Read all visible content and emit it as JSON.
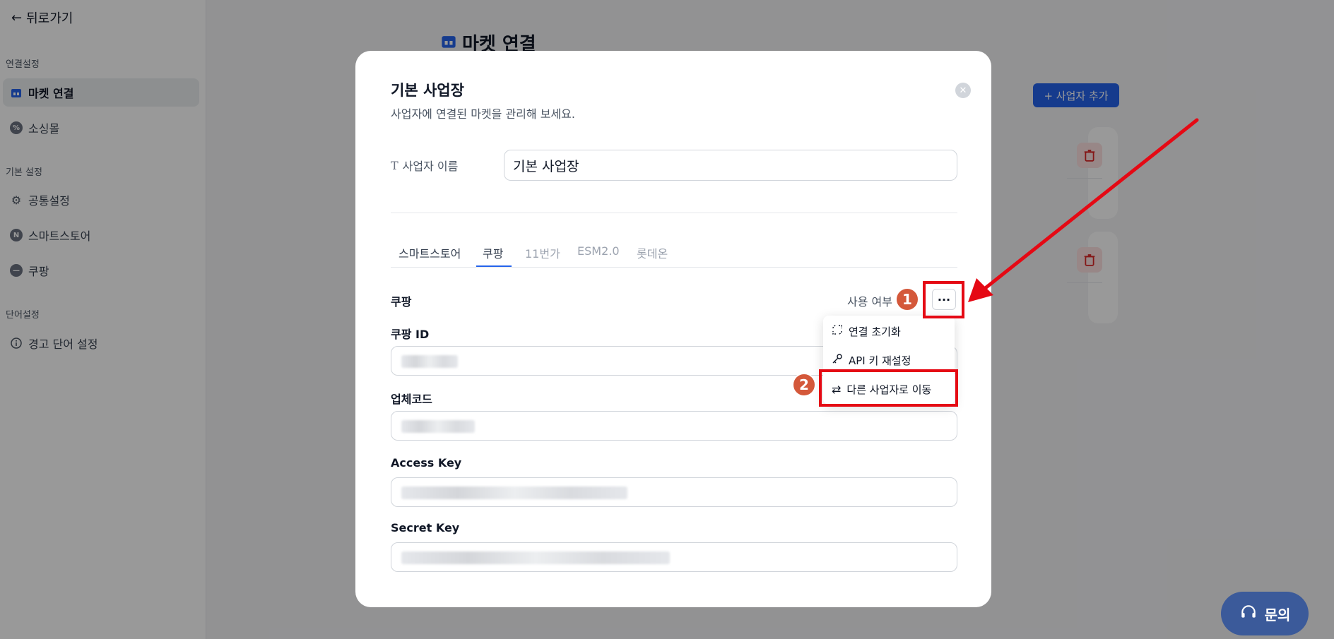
{
  "sidebar": {
    "back_label": "뒤로가기",
    "sections": [
      {
        "title": "연결설정",
        "items": [
          {
            "label": "마켓 연결",
            "icon": "store-icon",
            "active": true
          },
          {
            "label": "소싱몰",
            "icon": "percent-icon"
          }
        ]
      },
      {
        "title": "기본 설정",
        "items": [
          {
            "label": "공통설정",
            "icon": "gear-icon"
          },
          {
            "label": "스마트스토어",
            "icon": "naver-icon"
          },
          {
            "label": "쿠팡",
            "icon": "coupang-icon"
          }
        ]
      },
      {
        "title": "단어설정",
        "items": [
          {
            "label": "경고 단어 설정",
            "icon": "info-icon"
          }
        ]
      }
    ]
  },
  "main": {
    "title": "마켓 연결",
    "add_button_label": "+ 사업자 추가"
  },
  "modal": {
    "title": "기본 사업장",
    "subtitle": "사업자에 연결된 마켓을 관리해 보세요.",
    "name_label": "사업자 이름",
    "name_value": "기본 사업장",
    "tabs": [
      "스마트스토어",
      "쿠팡",
      "11번가",
      "ESM2.0",
      "롯데온"
    ],
    "active_tab": "쿠팡",
    "section_title": "쿠팡",
    "use_label": "사용 여부",
    "fields": [
      {
        "label": "쿠팡 ID"
      },
      {
        "label": "업체코드"
      },
      {
        "label": "Access Key"
      },
      {
        "label": "Secret Key"
      }
    ],
    "menu": [
      {
        "label": "연결 초기화",
        "icon": "unlink-icon"
      },
      {
        "label": "API 키 재설정",
        "icon": "key-icon"
      },
      {
        "label": "다른 사업자로 이동",
        "icon": "swap-icon"
      }
    ]
  },
  "annotations": {
    "badge1": "1",
    "badge2": "2",
    "highlight_color": "#e50914",
    "badge_color": "#d4583a"
  },
  "help_button_label": "문의",
  "colors": {
    "accent": "#2563eb",
    "danger": "#dc2626"
  }
}
